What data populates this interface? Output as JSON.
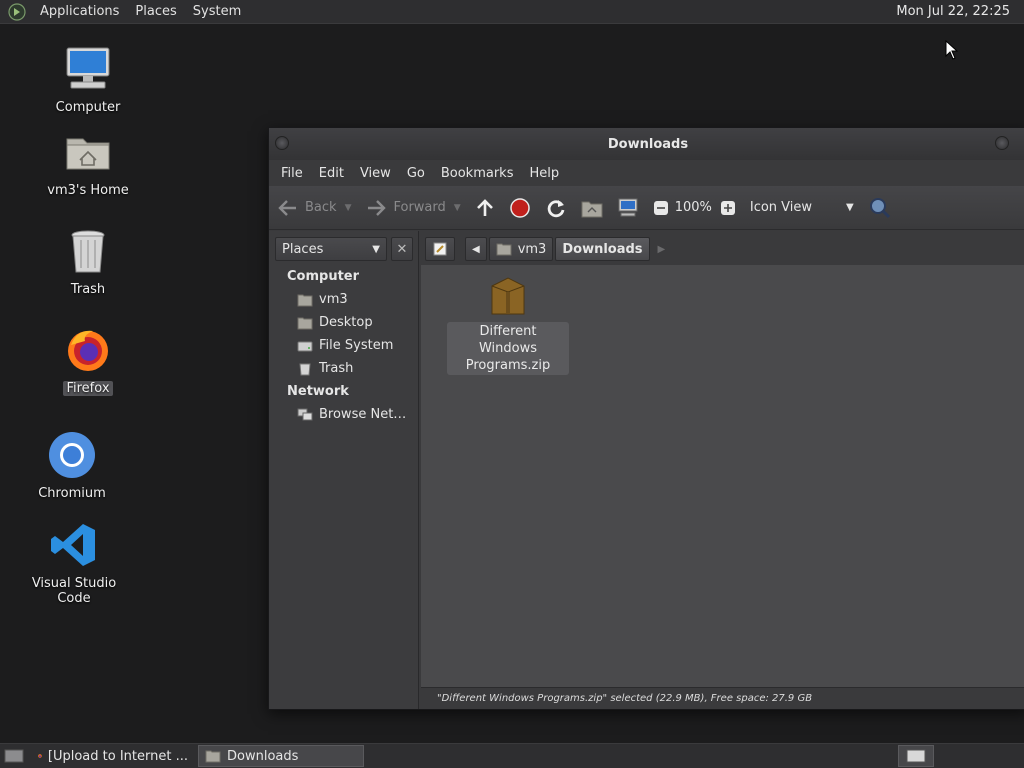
{
  "top_panel": {
    "menus": [
      "Applications",
      "Places",
      "System"
    ],
    "clock": "Mon Jul 22, 22:25"
  },
  "desktop": {
    "icons": [
      {
        "label": "Computer",
        "icon": "computer-icon"
      },
      {
        "label": "vm3's Home",
        "icon": "home-folder-icon"
      },
      {
        "label": "Trash",
        "icon": "trash-icon"
      },
      {
        "label": "Firefox",
        "icon": "firefox-icon",
        "selected": true
      },
      {
        "label": "Chromium",
        "icon": "chromium-icon"
      },
      {
        "label": "Visual Studio Code",
        "icon": "vscode-icon"
      }
    ]
  },
  "window": {
    "title": "Downloads",
    "menu": [
      "File",
      "Edit",
      "View",
      "Go",
      "Bookmarks",
      "Help"
    ],
    "toolbar": {
      "back": "Back",
      "forward": "Forward",
      "zoom": "100%",
      "view_mode": "Icon View"
    },
    "sidebar": {
      "selector": "Places",
      "sections": [
        {
          "title": "Computer",
          "items": [
            "vm3",
            "Desktop",
            "File System",
            "Trash"
          ]
        },
        {
          "title": "Network",
          "items": [
            "Browse Net…"
          ]
        }
      ]
    },
    "pathbar": [
      "vm3",
      "Downloads"
    ],
    "files": [
      {
        "name_line1": "Different Windows",
        "name_line2": "Programs.zip",
        "icon": "archive-icon"
      }
    ],
    "status": "\"Different Windows Programs.zip\" selected (22.9 MB), Free space: 27.9 GB"
  },
  "taskbar": {
    "tasks": [
      {
        "label": "[Upload to Internet ...",
        "icon": "firefox-icon",
        "active": false
      },
      {
        "label": "Downloads",
        "icon": "folder-icon",
        "active": true
      }
    ]
  },
  "colors": {
    "desktop_bg": "#1c1c1d",
    "panel_bg": "#2e2e30",
    "window_bg": "#3a3a3c",
    "content_bg": "#4a4a4c",
    "stop_red": "#c0201c"
  }
}
